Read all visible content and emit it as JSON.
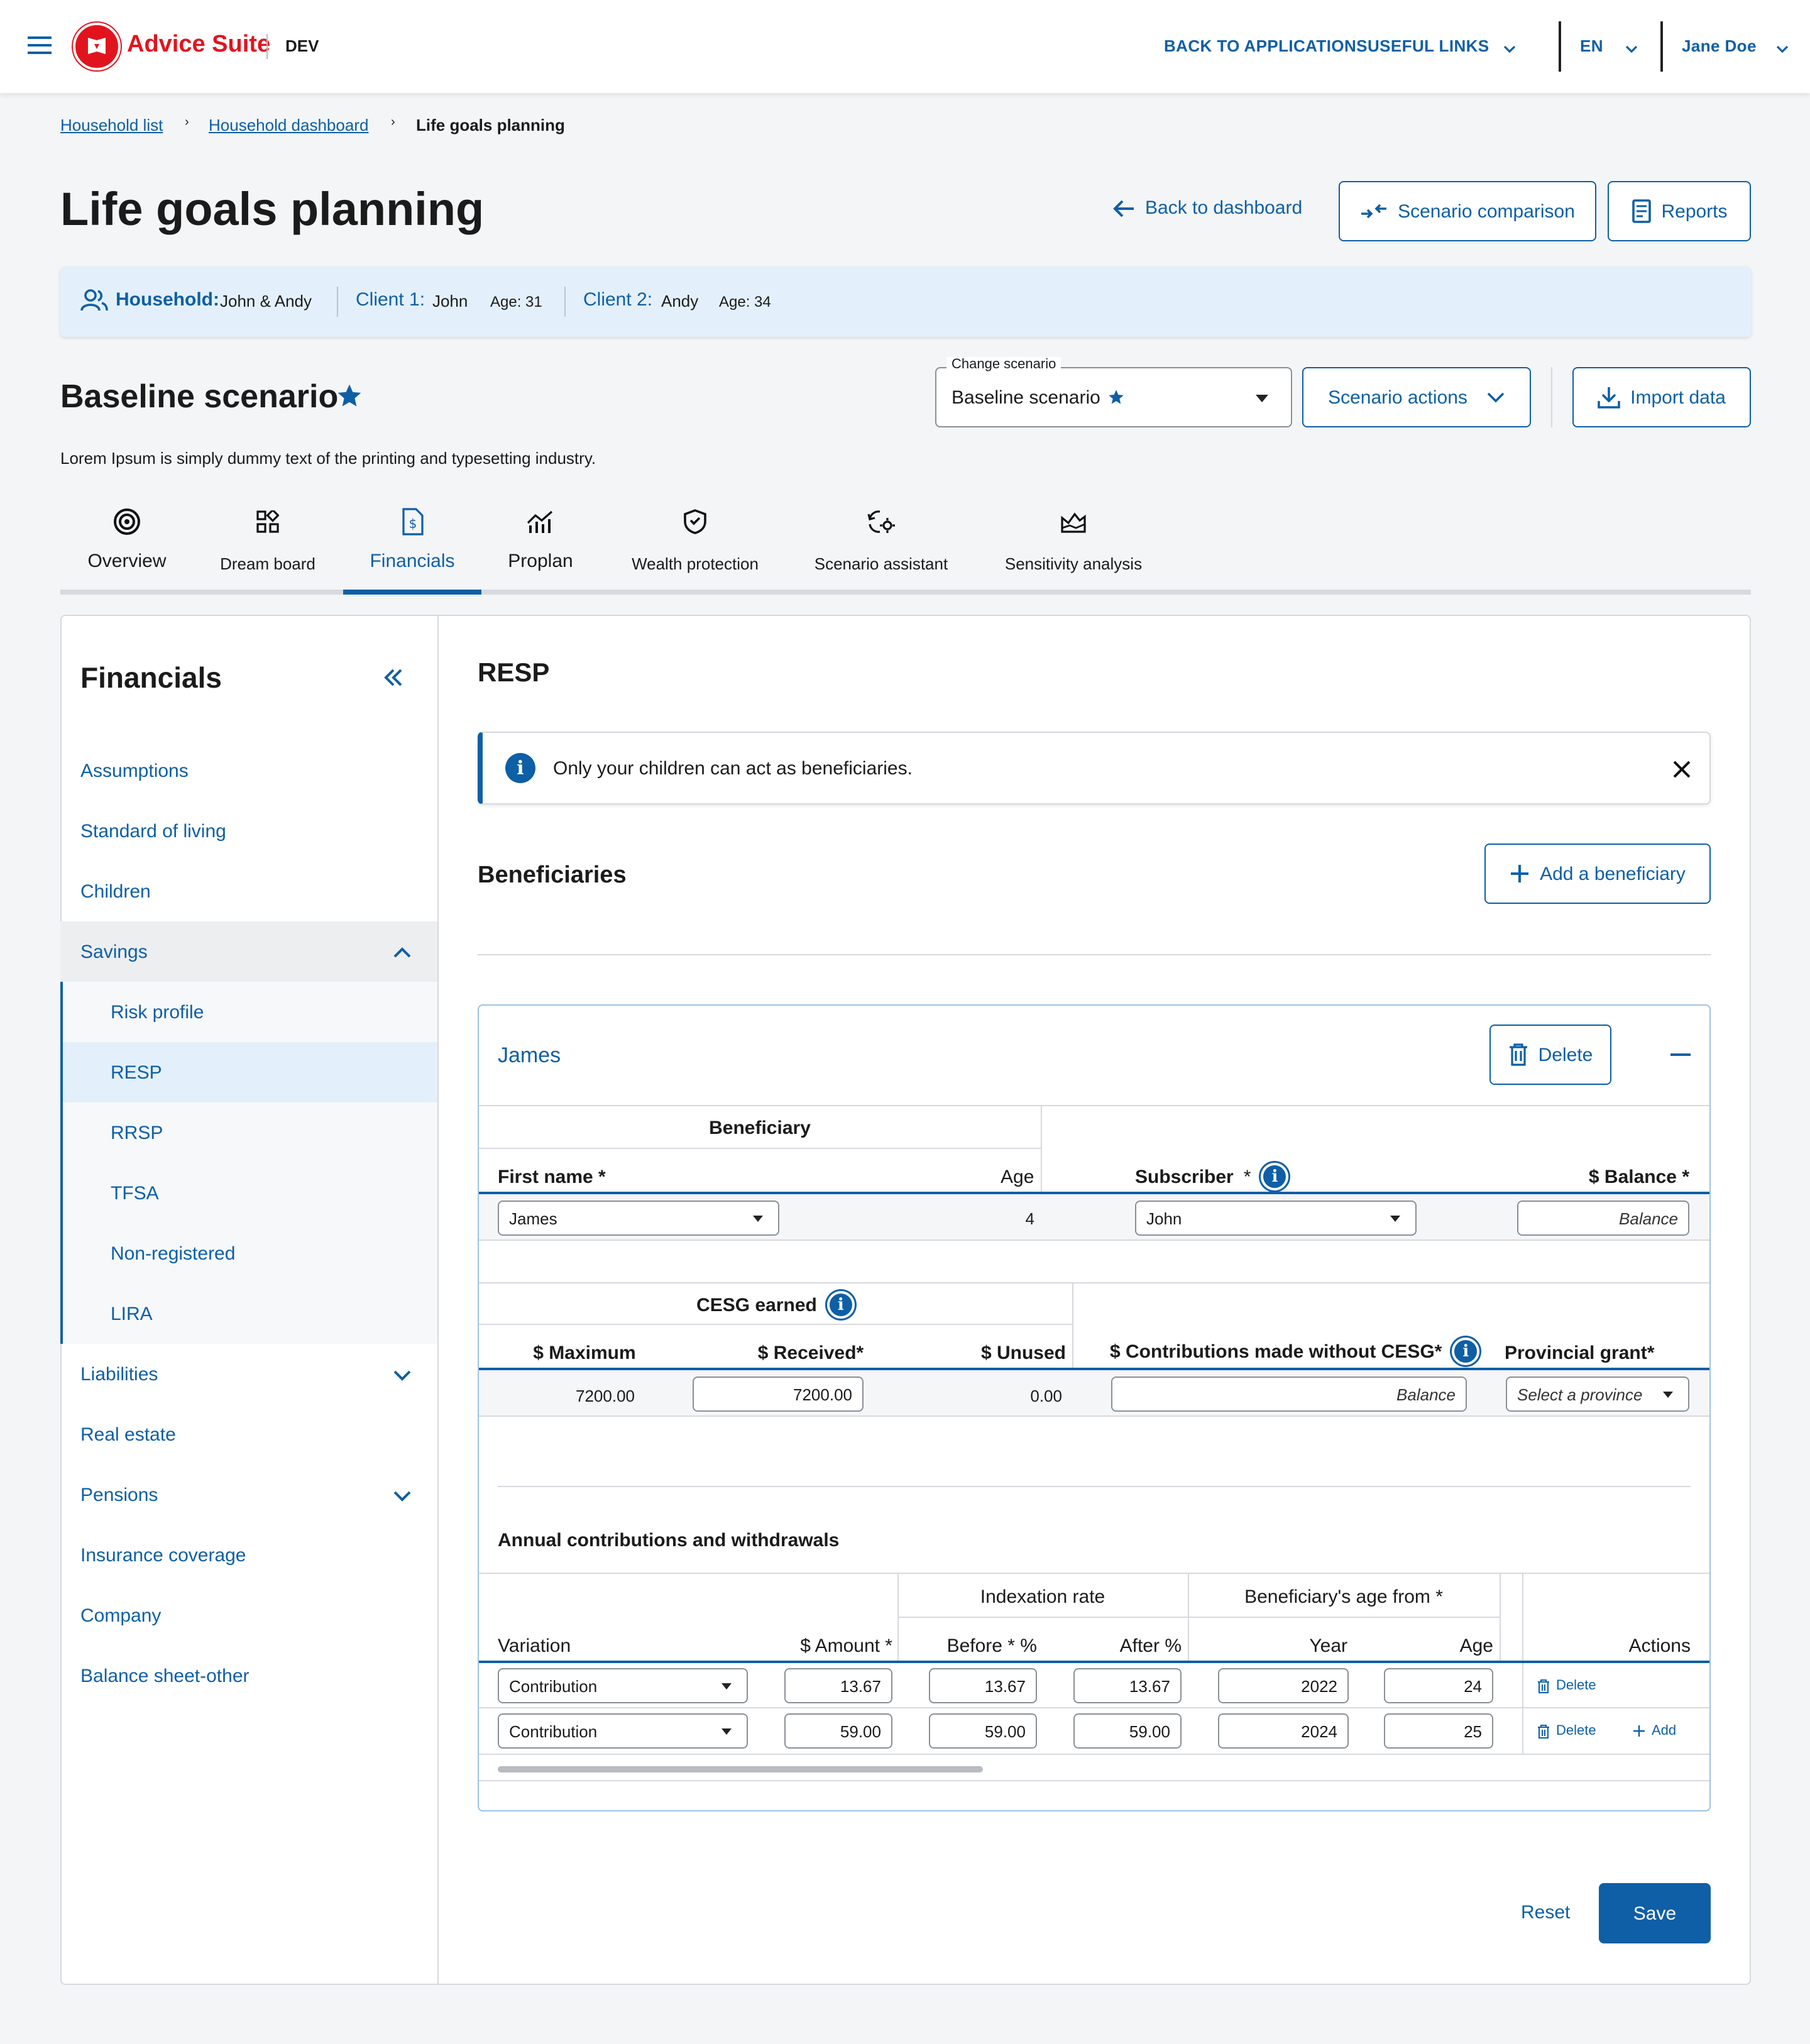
{
  "header": {
    "app_name": "Advice Suite",
    "env": "DEV",
    "back_to_apps": "BACK TO APPLICATIONS",
    "useful_links": "USEFUL LINKS",
    "lang": "EN",
    "user": "Jane Doe"
  },
  "breadcrumb": {
    "item1": "Household list",
    "item2": "Household dashboard",
    "current": "Life goals planning"
  },
  "page": {
    "title": "Life goals planning",
    "back": "Back to dashboard",
    "comparison": "Scenario comparison",
    "reports": "Reports"
  },
  "household": {
    "label": "Household:",
    "names": "John & Andy",
    "c1_label": "Client 1:",
    "c1_name": "John",
    "c1_age": "Age: 31",
    "c2_label": "Client 2:",
    "c2_name": "Andy",
    "c2_age": "Age: 34"
  },
  "scenario": {
    "title": "Baseline scenario",
    "desc": "Lorem Ipsum is simply dummy text of the printing and typesetting industry.",
    "change_label": "Change scenario",
    "selected": "Baseline scenario",
    "actions": "Scenario actions",
    "import": "Import data"
  },
  "tabs": [
    "Overview",
    "Dream board",
    "Financials",
    "Proplan",
    "Wealth protection",
    "Scenario assistant",
    "Sensitivity analysis"
  ],
  "sidebar": {
    "title": "Financials",
    "items": [
      "Assumptions",
      "Standard of living",
      "Children",
      "Savings",
      "Liabilities",
      "Real estate",
      "Pensions",
      "Insurance coverage",
      "Company",
      "Balance sheet-other"
    ],
    "sub": [
      "Risk profile",
      "RESP",
      "RRSP",
      "TFSA",
      "Non-registered",
      "LIRA"
    ]
  },
  "main": {
    "title": "RESP",
    "alert": "Only your children can act as beneficiaries.",
    "beneficiaries": "Beneficiaries",
    "add_beneficiary": "Add a beneficiary"
  },
  "panel": {
    "name": "James",
    "delete": "Delete",
    "ben_group": "Beneficiary",
    "first_name": "First name *",
    "age": "Age",
    "subscriber": "Subscriber",
    "req": "*",
    "balance": "$ Balance *",
    "first_name_val": "James",
    "age_val": "4",
    "subscriber_val": "John",
    "balance_ph": "Balance",
    "cesg": "CESG earned",
    "maximum": "$ Maximum",
    "received": "$ Received*",
    "unused": "$ Unused",
    "contrib_wo": "$ Contributions made without CESG*",
    "prov": "Provincial grant*",
    "max_val": "7200.00",
    "received_val": "7200.00",
    "unused_val": "0.00",
    "contrib_ph": "Balance",
    "prov_ph": "Select a province",
    "annual": "Annual contributions and withdrawals",
    "idx": "Indexation rate",
    "ben_age_from": "Beneficiary's age from *",
    "variation": "Variation",
    "amount": "$ Amount *",
    "before": "Before * %",
    "after": "After %",
    "year": "Year",
    "age_col": "Age",
    "actions": "Actions",
    "add": "Add",
    "rows": [
      {
        "variation": "Contribution",
        "amount": "13.67",
        "before": "13.67",
        "after": "13.67",
        "year": "2022",
        "age": "24"
      },
      {
        "variation": "Contribution",
        "amount": "59.00",
        "before": "59.00",
        "after": "59.00",
        "year": "2024",
        "age": "25"
      }
    ]
  },
  "footer": {
    "reset": "Reset",
    "save": "Save"
  },
  "colors": {
    "primary": "#0e5fa6",
    "brand": "#e1141e",
    "band": "#e3f0fb"
  }
}
